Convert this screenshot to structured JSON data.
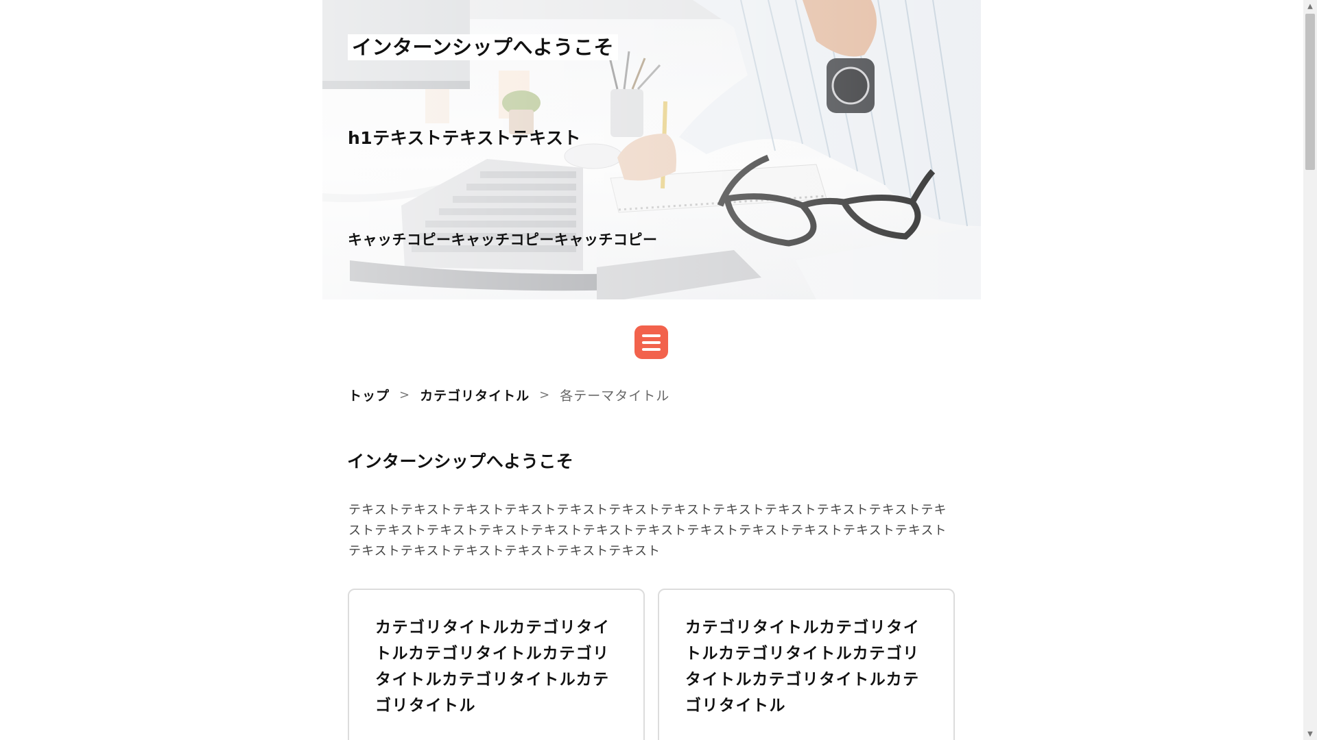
{
  "hero": {
    "welcome": "インターンシップへようこそ",
    "h1": "h1テキストテキストテキスト",
    "catchcopy": "キャッチコピーキャッチコピーキャッチコピー"
  },
  "menu": {
    "icon": "hamburger-icon"
  },
  "breadcrumb": {
    "items": [
      {
        "label": "トップ"
      },
      {
        "label": "カテゴリタイトル"
      },
      {
        "label": "各テーマタイトル"
      }
    ],
    "separator": ">"
  },
  "main": {
    "title": "インターンシップへようこそ",
    "body": "テキストテキストテキストテキストテキストテキストテキストテキストテキストテキストテキストテキストテキストテキストテキストテキストテキストテキストテキストテキストテキストテキストテキストテキストテキストテキストテキストテキストテキスト",
    "cards": [
      {
        "title": "カテゴリタイトルカテゴリタイトルカテゴリタイトルカテゴリタイトルカテゴリタイトルカテゴリタイトル"
      },
      {
        "title": "カテゴリタイトルカテゴリタイトルカテゴリタイトルカテゴリタイトルカテゴリタイトルカテゴリタイトル"
      }
    ]
  },
  "colors": {
    "accent": "#f2624c",
    "card_border": "#dcdcdc",
    "text": "#111111"
  }
}
